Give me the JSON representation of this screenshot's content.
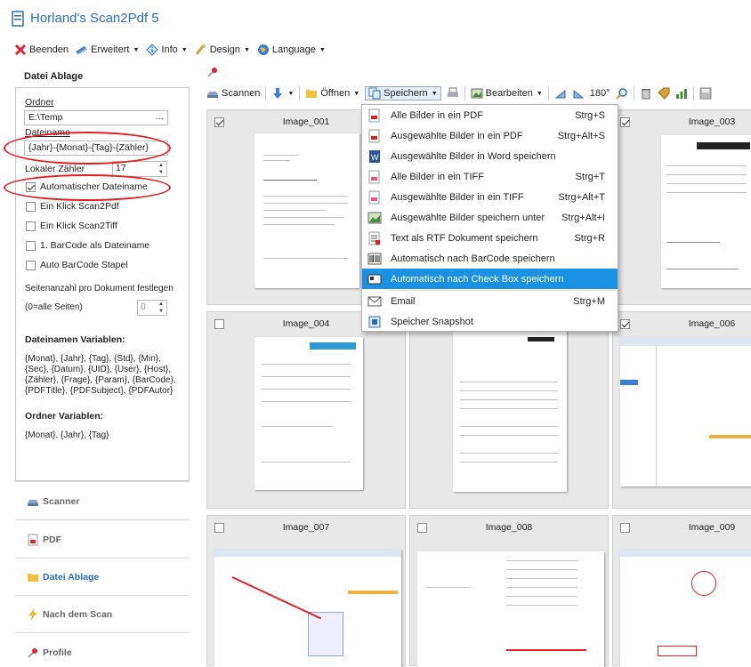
{
  "app": {
    "title": "Horland's Scan2Pdf 5"
  },
  "menubar": [
    {
      "label": "Beenden",
      "icon": "close-x-icon",
      "caret": false
    },
    {
      "label": "Erweitert",
      "icon": "wand-icon",
      "caret": true
    },
    {
      "label": "Info",
      "icon": "info-icon",
      "caret": true
    },
    {
      "label": "Design",
      "icon": "brush-icon",
      "caret": true
    },
    {
      "label": "Language",
      "icon": "globe-icon",
      "caret": true
    }
  ],
  "left_panel": {
    "header": "Datei Ablage",
    "ordner_label": "Ordner",
    "ordner_value": "E:\\Temp",
    "browse_label": "...",
    "dateiname_label": "Dateiname",
    "dateiname_value": "{Jahr}-{Monat}-{Tag}-{Zähler}",
    "zaehler_label": "Lokaler Zähler",
    "zaehler_value": "17",
    "checkboxes": [
      {
        "label": "Automatischer Dateiname",
        "checked": true
      },
      {
        "label": "Ein Klick Scan2Pdf",
        "checked": false
      },
      {
        "label": "Ein Klick Scan2Tiff",
        "checked": false
      },
      {
        "label": "1. BarCode als Dateiname",
        "checked": false
      },
      {
        "label": "Auto BarCode Stapel",
        "checked": false
      }
    ],
    "seiten_label": "Seitenanzahl pro Dokument festlegen",
    "seiten_hint": "(0=alle Seiten)",
    "seiten_value": "0",
    "vars_title": "Dateinamen Variablen:",
    "vars_text": "{Monat}, {Jahr}, {Tag}, {Std}, {Min}, {Sec}, {Datum}, {UID}, {User}, {Host}, {Zähler}, {Frage}, {Param}, {BarCode}, {PDFTitle}, {PDFSubject}, {PDFAutor}",
    "ordner_vars_title": "Ordner Variablen:",
    "ordner_vars_text": "{Monat}, {Jahr}, {Tag}"
  },
  "nav": [
    {
      "label": "Scanner",
      "icon": "scanner-icon",
      "active": false
    },
    {
      "label": "PDF",
      "icon": "pdf-icon",
      "active": false
    },
    {
      "label": "Datei Ablage",
      "icon": "folder-icon",
      "active": true
    },
    {
      "label": "Nach dem Scan",
      "icon": "lightning-icon",
      "active": false
    },
    {
      "label": "Profile",
      "icon": "pin-icon",
      "active": false
    }
  ],
  "toolbar": {
    "scannen": "Scannen",
    "oeffnen": "Öffnen",
    "speichern": "Speichern",
    "bearbeiten": "Bearbeiten",
    "rotate": "180°"
  },
  "grid": [
    {
      "title": "Image_001",
      "checked": true
    },
    {
      "title": "Image_003",
      "checked": true
    },
    {
      "title": "Image_004",
      "checked": false
    },
    {
      "title": "Image_006",
      "checked": true
    },
    {
      "title": "Image_007",
      "checked": false
    },
    {
      "title": "Image_008",
      "checked": false
    },
    {
      "title": "Image_009",
      "checked": false
    }
  ],
  "dropdown": [
    {
      "label": "Alle Bilder in ein PDF",
      "shortcut": "Strg+S",
      "icon": "pdf-icon"
    },
    {
      "label": "Ausgewählte Bilder in ein PDF",
      "shortcut": "Strg+Alt+S",
      "icon": "pdf-icon"
    },
    {
      "label": "Ausgewählte Bilder in Word speichern",
      "shortcut": "",
      "icon": "word-icon"
    },
    {
      "label": "Alle Bilder in ein TIFF",
      "shortcut": "Strg+T",
      "icon": "tiff-icon"
    },
    {
      "label": "Ausgewählte Bilder in ein TIFF",
      "shortcut": "Strg+Alt+T",
      "icon": "tiff-icon"
    },
    {
      "label": "Ausgewählte Bilder speichern unter",
      "shortcut": "Strg+Alt+I",
      "icon": "image-icon"
    },
    {
      "label": "Text als RTF Dokument speichern",
      "shortcut": "Strg+R",
      "icon": "rtf-icon"
    },
    {
      "label": "Automatisch nach BarCode speichern",
      "shortcut": "",
      "icon": "barcode-icon"
    },
    {
      "label": "Automatisch nach Check Box speichern",
      "shortcut": "",
      "icon": "checkbox-icon"
    },
    {
      "label": "Email",
      "shortcut": "Strg+M",
      "icon": "email-icon"
    },
    {
      "label": "Speicher Snapshot",
      "shortcut": "",
      "icon": "snapshot-icon"
    }
  ],
  "colors": {
    "accent": "#2a6db6",
    "highlight": "#1a91e3",
    "annotation": "#e31e24"
  }
}
